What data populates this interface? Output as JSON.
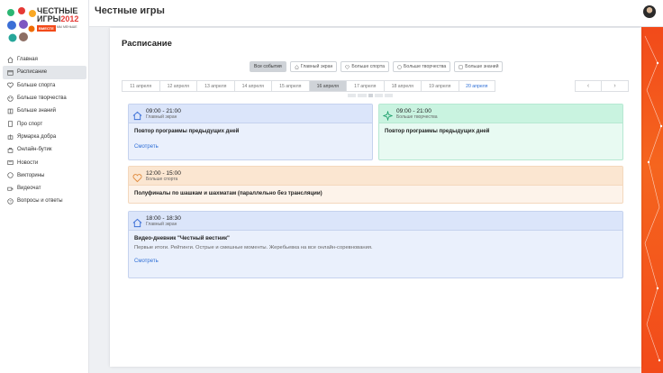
{
  "app": {
    "title": "Честные игры"
  },
  "logo": {
    "line1": "ЧЕСТНЫЕ",
    "line2": "ИГРЫ",
    "year": "2012",
    "badge": "ВМЕСТЕ",
    "tagline": "МЫ МЕНЬШЕ"
  },
  "sidebar": {
    "items": [
      {
        "label": "Главная",
        "icon": "home-icon"
      },
      {
        "label": "Расписание",
        "icon": "calendar-icon",
        "active": true
      },
      {
        "label": "Больше спорта",
        "icon": "heart-icon"
      },
      {
        "label": "Больше творчества",
        "icon": "palette-icon"
      },
      {
        "label": "Больше знаний",
        "icon": "book-icon"
      },
      {
        "label": "Про спорт",
        "icon": "doc-icon"
      },
      {
        "label": "Ярмарка добра",
        "icon": "gift-icon"
      },
      {
        "label": "Онлайн-бутик",
        "icon": "bag-icon"
      },
      {
        "label": "Новости",
        "icon": "news-icon"
      },
      {
        "label": "Викторины",
        "icon": "quiz-icon"
      },
      {
        "label": "Видеочат",
        "icon": "video-icon"
      },
      {
        "label": "Вопросы и ответы",
        "icon": "question-icon"
      }
    ]
  },
  "schedule": {
    "title": "Расписание",
    "filters": [
      {
        "label": "Все события",
        "active": true
      },
      {
        "label": "Главный экран",
        "icon": "home-icon"
      },
      {
        "label": "Больше спорта",
        "icon": "heart-icon"
      },
      {
        "label": "Больше творчества",
        "icon": "palette-icon"
      },
      {
        "label": "Больше знаний",
        "icon": "book-icon"
      }
    ],
    "days": [
      {
        "label": "11 апреля"
      },
      {
        "label": "12 апреля"
      },
      {
        "label": "13 апреля"
      },
      {
        "label": "14 апреля"
      },
      {
        "label": "15 апреля"
      },
      {
        "label": "16 апреля",
        "active": true
      },
      {
        "label": "17 апреля"
      },
      {
        "label": "18 апреля"
      },
      {
        "label": "19 апреля"
      },
      {
        "label": "20 апреля",
        "link": true
      }
    ],
    "pager": {
      "prev": "‹",
      "next": "›"
    },
    "events": [
      {
        "time": "09:00 - 21:00",
        "category": "Главный экран",
        "title": "Повтор программы предыдущих дней",
        "description": "",
        "link": "Смотреть",
        "color": "#dbe5fa"
      },
      {
        "time": "09:00 - 21:00",
        "category": "Больше творчества",
        "title": "Повтор программы предыдущих дней",
        "description": "",
        "link": "",
        "color": "#c9f3e0"
      },
      {
        "time": "12:00 - 15:00",
        "category": "Больше спорта",
        "title": "Полуфиналы по шашкам и шахматам (параллельно без трансляции)",
        "description": "",
        "link": "",
        "color": "#fbe6d1"
      },
      {
        "time": "18:00 - 18:30",
        "category": "Главный экран",
        "title": "Видео-дневник \"Честный вестник\"",
        "description": "Первые итоги. Рейтинги. Острые и смешные моменты. Жеребьевка на все онлайн-соревнования.",
        "link": "Смотреть",
        "color": "#dbe5fa"
      }
    ]
  }
}
